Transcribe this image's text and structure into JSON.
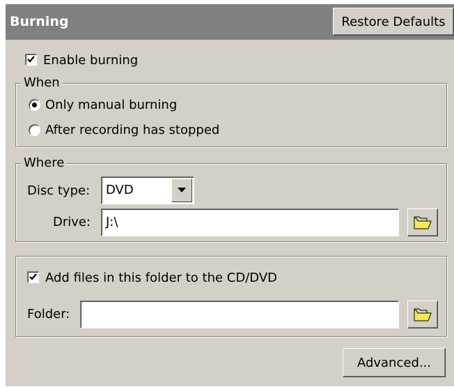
{
  "header": {
    "title": "Burning",
    "restore_label": "Restore Defaults"
  },
  "enable_burning": {
    "label": "Enable burning",
    "checked": true
  },
  "when": {
    "title": "When",
    "options": [
      {
        "label": "Only manual burning",
        "selected": true
      },
      {
        "label": "After recording has stopped",
        "selected": false
      }
    ]
  },
  "where": {
    "title": "Where",
    "disc_type_label": "Disc type:",
    "disc_type_value": "DVD",
    "drive_label": "Drive:",
    "drive_value": "J:\\"
  },
  "add_files": {
    "label": "Add files in this folder to the CD/DVD",
    "checked": true,
    "folder_label": "Folder:",
    "folder_value": ""
  },
  "advanced_label": "Advanced...",
  "icons": {
    "browse": "folder-icon",
    "dropdown": "chevron-down-icon",
    "check": "check-icon"
  },
  "colors": {
    "panel": "#d4d0c8",
    "header": "#808080",
    "folder": "#f8e850"
  }
}
